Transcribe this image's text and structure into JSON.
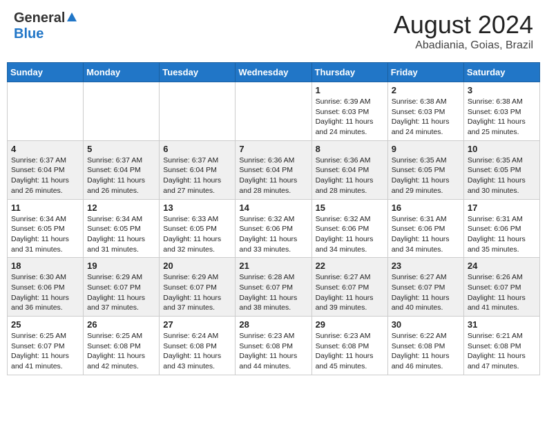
{
  "header": {
    "logo_general": "General",
    "logo_blue": "Blue",
    "title": "August 2024",
    "location": "Abadiania, Goias, Brazil"
  },
  "calendar": {
    "days_of_week": [
      "Sunday",
      "Monday",
      "Tuesday",
      "Wednesday",
      "Thursday",
      "Friday",
      "Saturday"
    ],
    "weeks": [
      [
        {
          "day": "",
          "info": ""
        },
        {
          "day": "",
          "info": ""
        },
        {
          "day": "",
          "info": ""
        },
        {
          "day": "",
          "info": ""
        },
        {
          "day": "1",
          "info": "Sunrise: 6:39 AM\nSunset: 6:03 PM\nDaylight: 11 hours\nand 24 minutes."
        },
        {
          "day": "2",
          "info": "Sunrise: 6:38 AM\nSunset: 6:03 PM\nDaylight: 11 hours\nand 24 minutes."
        },
        {
          "day": "3",
          "info": "Sunrise: 6:38 AM\nSunset: 6:03 PM\nDaylight: 11 hours\nand 25 minutes."
        }
      ],
      [
        {
          "day": "4",
          "info": "Sunrise: 6:37 AM\nSunset: 6:04 PM\nDaylight: 11 hours\nand 26 minutes."
        },
        {
          "day": "5",
          "info": "Sunrise: 6:37 AM\nSunset: 6:04 PM\nDaylight: 11 hours\nand 26 minutes."
        },
        {
          "day": "6",
          "info": "Sunrise: 6:37 AM\nSunset: 6:04 PM\nDaylight: 11 hours\nand 27 minutes."
        },
        {
          "day": "7",
          "info": "Sunrise: 6:36 AM\nSunset: 6:04 PM\nDaylight: 11 hours\nand 28 minutes."
        },
        {
          "day": "8",
          "info": "Sunrise: 6:36 AM\nSunset: 6:04 PM\nDaylight: 11 hours\nand 28 minutes."
        },
        {
          "day": "9",
          "info": "Sunrise: 6:35 AM\nSunset: 6:05 PM\nDaylight: 11 hours\nand 29 minutes."
        },
        {
          "day": "10",
          "info": "Sunrise: 6:35 AM\nSunset: 6:05 PM\nDaylight: 11 hours\nand 30 minutes."
        }
      ],
      [
        {
          "day": "11",
          "info": "Sunrise: 6:34 AM\nSunset: 6:05 PM\nDaylight: 11 hours\nand 31 minutes."
        },
        {
          "day": "12",
          "info": "Sunrise: 6:34 AM\nSunset: 6:05 PM\nDaylight: 11 hours\nand 31 minutes."
        },
        {
          "day": "13",
          "info": "Sunrise: 6:33 AM\nSunset: 6:05 PM\nDaylight: 11 hours\nand 32 minutes."
        },
        {
          "day": "14",
          "info": "Sunrise: 6:32 AM\nSunset: 6:06 PM\nDaylight: 11 hours\nand 33 minutes."
        },
        {
          "day": "15",
          "info": "Sunrise: 6:32 AM\nSunset: 6:06 PM\nDaylight: 11 hours\nand 34 minutes."
        },
        {
          "day": "16",
          "info": "Sunrise: 6:31 AM\nSunset: 6:06 PM\nDaylight: 11 hours\nand 34 minutes."
        },
        {
          "day": "17",
          "info": "Sunrise: 6:31 AM\nSunset: 6:06 PM\nDaylight: 11 hours\nand 35 minutes."
        }
      ],
      [
        {
          "day": "18",
          "info": "Sunrise: 6:30 AM\nSunset: 6:06 PM\nDaylight: 11 hours\nand 36 minutes."
        },
        {
          "day": "19",
          "info": "Sunrise: 6:29 AM\nSunset: 6:07 PM\nDaylight: 11 hours\nand 37 minutes."
        },
        {
          "day": "20",
          "info": "Sunrise: 6:29 AM\nSunset: 6:07 PM\nDaylight: 11 hours\nand 37 minutes."
        },
        {
          "day": "21",
          "info": "Sunrise: 6:28 AM\nSunset: 6:07 PM\nDaylight: 11 hours\nand 38 minutes."
        },
        {
          "day": "22",
          "info": "Sunrise: 6:27 AM\nSunset: 6:07 PM\nDaylight: 11 hours\nand 39 minutes."
        },
        {
          "day": "23",
          "info": "Sunrise: 6:27 AM\nSunset: 6:07 PM\nDaylight: 11 hours\nand 40 minutes."
        },
        {
          "day": "24",
          "info": "Sunrise: 6:26 AM\nSunset: 6:07 PM\nDaylight: 11 hours\nand 41 minutes."
        }
      ],
      [
        {
          "day": "25",
          "info": "Sunrise: 6:25 AM\nSunset: 6:07 PM\nDaylight: 11 hours\nand 41 minutes."
        },
        {
          "day": "26",
          "info": "Sunrise: 6:25 AM\nSunset: 6:08 PM\nDaylight: 11 hours\nand 42 minutes."
        },
        {
          "day": "27",
          "info": "Sunrise: 6:24 AM\nSunset: 6:08 PM\nDaylight: 11 hours\nand 43 minutes."
        },
        {
          "day": "28",
          "info": "Sunrise: 6:23 AM\nSunset: 6:08 PM\nDaylight: 11 hours\nand 44 minutes."
        },
        {
          "day": "29",
          "info": "Sunrise: 6:23 AM\nSunset: 6:08 PM\nDaylight: 11 hours\nand 45 minutes."
        },
        {
          "day": "30",
          "info": "Sunrise: 6:22 AM\nSunset: 6:08 PM\nDaylight: 11 hours\nand 46 minutes."
        },
        {
          "day": "31",
          "info": "Sunrise: 6:21 AM\nSunset: 6:08 PM\nDaylight: 11 hours\nand 47 minutes."
        }
      ]
    ]
  }
}
